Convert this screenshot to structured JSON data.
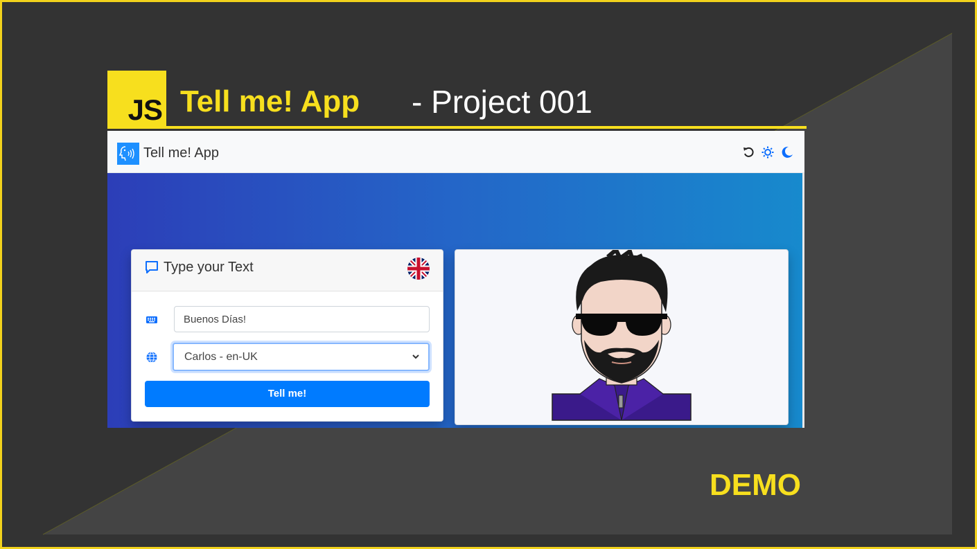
{
  "banner": {
    "badge_text": "JS",
    "title": "Tell me! App",
    "subtitle": "- Project 001",
    "footer_label": "DEMO"
  },
  "app": {
    "navbar": {
      "brand": "Tell me! App",
      "icons": [
        "reset-icon",
        "sun-icon",
        "moon-icon"
      ]
    },
    "input_card": {
      "title": "Type your Text",
      "flag": "uk-flag-icon",
      "text_field": {
        "value": "Buenos Días!"
      },
      "voice_select": {
        "selected": "Carlos - en-UK"
      },
      "submit_label": "Tell me!"
    },
    "avatar_card": {
      "image": "avatar-illustration"
    }
  },
  "colors": {
    "accent_yellow": "#f7df1e",
    "primary_button": "#007bff",
    "background_dark": "#333333",
    "gradient_start": "#2c3eb8",
    "gradient_end": "#178acd"
  }
}
